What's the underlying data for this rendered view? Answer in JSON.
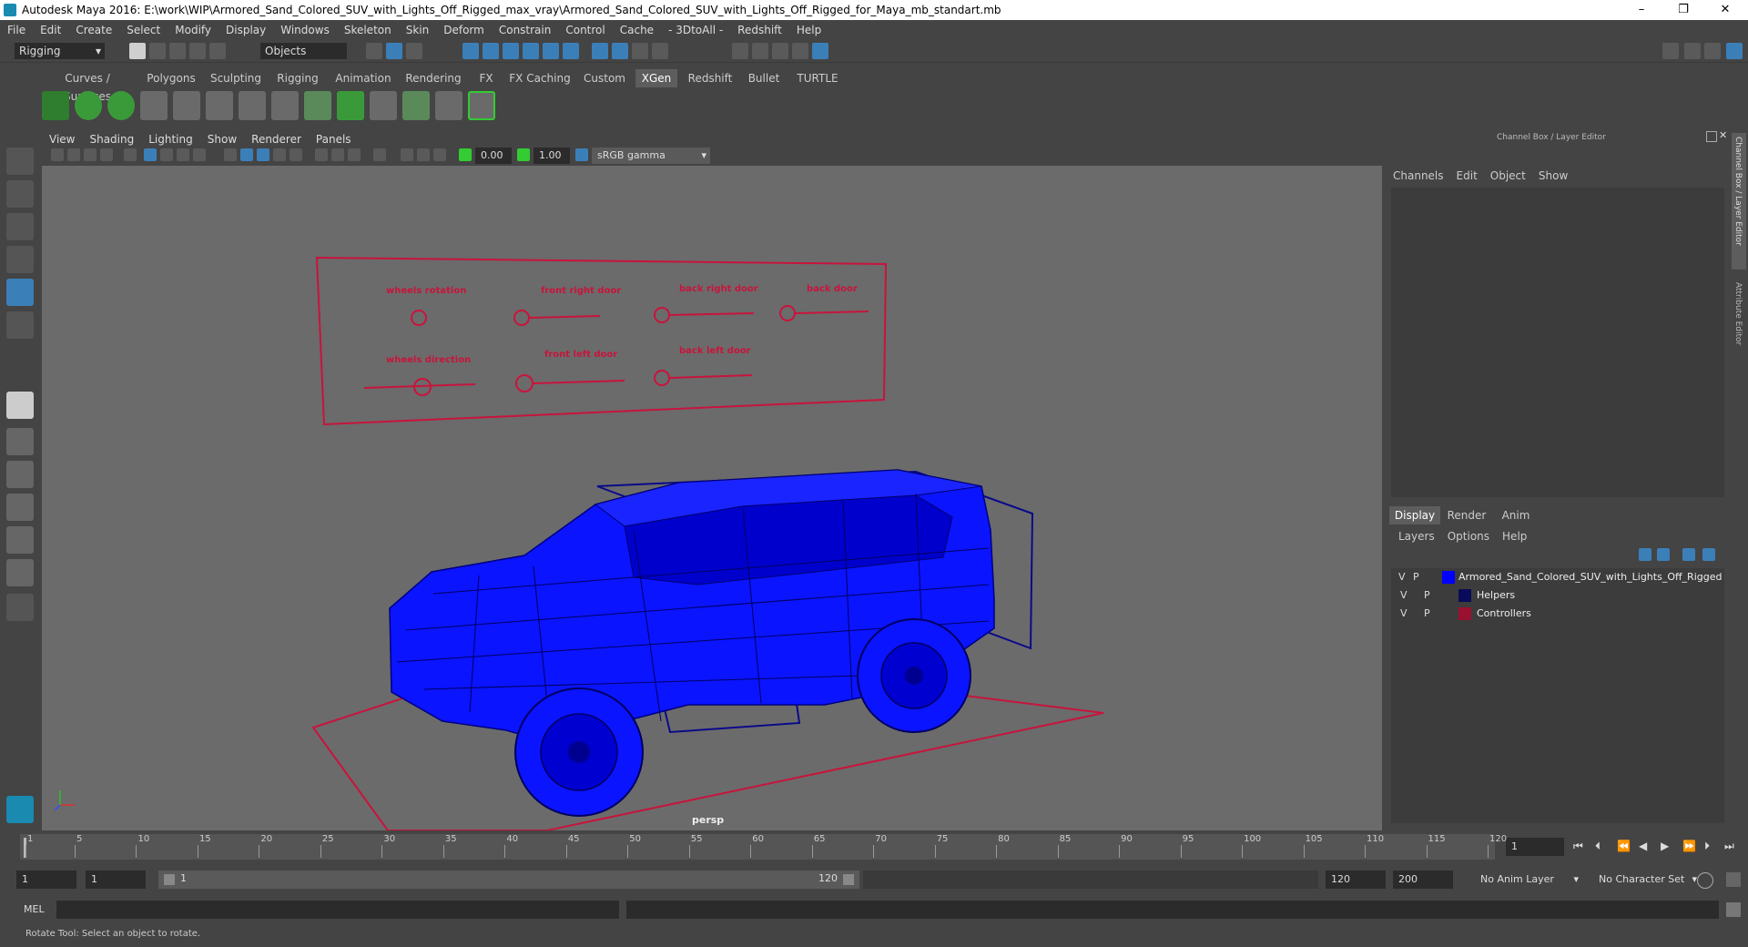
{
  "window": {
    "title": "Autodesk Maya 2016: E:\\work\\WIP\\Armored_Sand_Colored_SUV_with_Lights_Off_Rigged_max_vray\\Armored_Sand_Colored_SUV_with_Lights_Off_Rigged_for_Maya_mb_standart.mb",
    "minimize": "–",
    "restore": "❐",
    "close": "✕"
  },
  "menu": [
    "File",
    "Edit",
    "Create",
    "Select",
    "Modify",
    "Display",
    "Windows",
    "Skeleton",
    "Skin",
    "Deform",
    "Constrain",
    "Control",
    "Cache",
    "- 3DtoAll -",
    "Redshift",
    "Help"
  ],
  "status": {
    "mode": "Rigging",
    "objects": "Objects"
  },
  "shelf_tabs": [
    {
      "label": "Curves / Surfaces",
      "active": false
    },
    {
      "label": "Polygons",
      "active": false
    },
    {
      "label": "Sculpting",
      "active": false
    },
    {
      "label": "Rigging",
      "active": false
    },
    {
      "label": "Animation",
      "active": false
    },
    {
      "label": "Rendering",
      "active": false
    },
    {
      "label": "FX",
      "active": false
    },
    {
      "label": "FX Caching",
      "active": false
    },
    {
      "label": "Custom",
      "active": false
    },
    {
      "label": "XGen",
      "active": true
    },
    {
      "label": "Redshift",
      "active": false
    },
    {
      "label": "Bullet",
      "active": false
    },
    {
      "label": "TURTLE",
      "active": false
    }
  ],
  "viewport": {
    "menu": [
      "View",
      "Shading",
      "Lighting",
      "Show",
      "Renderer",
      "Panels"
    ],
    "exposure": "0.00",
    "gamma": "1.00",
    "colorspace": "sRGB gamma",
    "camera": "persp",
    "controls": {
      "wheels_rotation": "wheels rotation",
      "front_right_door": "front right door",
      "back_right_door": "back right door",
      "back_door": "back door",
      "wheels_direction": "wheels direction",
      "front_left_door": "front left door",
      "back_left_door": "back left door"
    }
  },
  "channel_box": {
    "title": "Channel Box / Layer Editor",
    "menu": [
      "Channels",
      "Edit",
      "Object",
      "Show"
    ],
    "side_tabs": [
      "Channel Box / Layer Editor",
      "Attribute Editor"
    ]
  },
  "layer_editor": {
    "tabs": [
      "Display",
      "Render",
      "Anim"
    ],
    "active_tab": "Display",
    "menu": [
      "Layers",
      "Options",
      "Help"
    ],
    "layers": [
      {
        "v": "V",
        "p": "P",
        "color": "#0000ff",
        "name": "Armored_Sand_Colored_SUV_with_Lights_Off_Rigged"
      },
      {
        "v": "V",
        "p": "P",
        "color": "#0a0a5a",
        "name": "Helpers"
      },
      {
        "v": "V",
        "p": "P",
        "color": "#9a1030",
        "name": "Controllers"
      }
    ]
  },
  "timeline": {
    "ticks": [
      "1",
      "5",
      "10",
      "15",
      "20",
      "25",
      "30",
      "35",
      "40",
      "45",
      "50",
      "55",
      "60",
      "65",
      "70",
      "75",
      "80",
      "85",
      "90",
      "95",
      "100",
      "105",
      "110",
      "115",
      "120"
    ],
    "current_frame": "1"
  },
  "range": {
    "start": "1",
    "playback_start": "1",
    "slider_start": "1",
    "slider_end": "120",
    "playback_end": "120",
    "end": "200",
    "anim_layer": "No Anim Layer",
    "character_set": "No Character Set"
  },
  "command_line": {
    "label": "MEL"
  },
  "help_line": "Rotate Tool: Select an object to rotate.",
  "colors": {
    "ui_bg": "#444444",
    "viewport_bg": "#6b6b6b",
    "wire_blue": "#0a14ff",
    "control_red": "#c8143c",
    "active_tab": "#5d5d5d"
  }
}
